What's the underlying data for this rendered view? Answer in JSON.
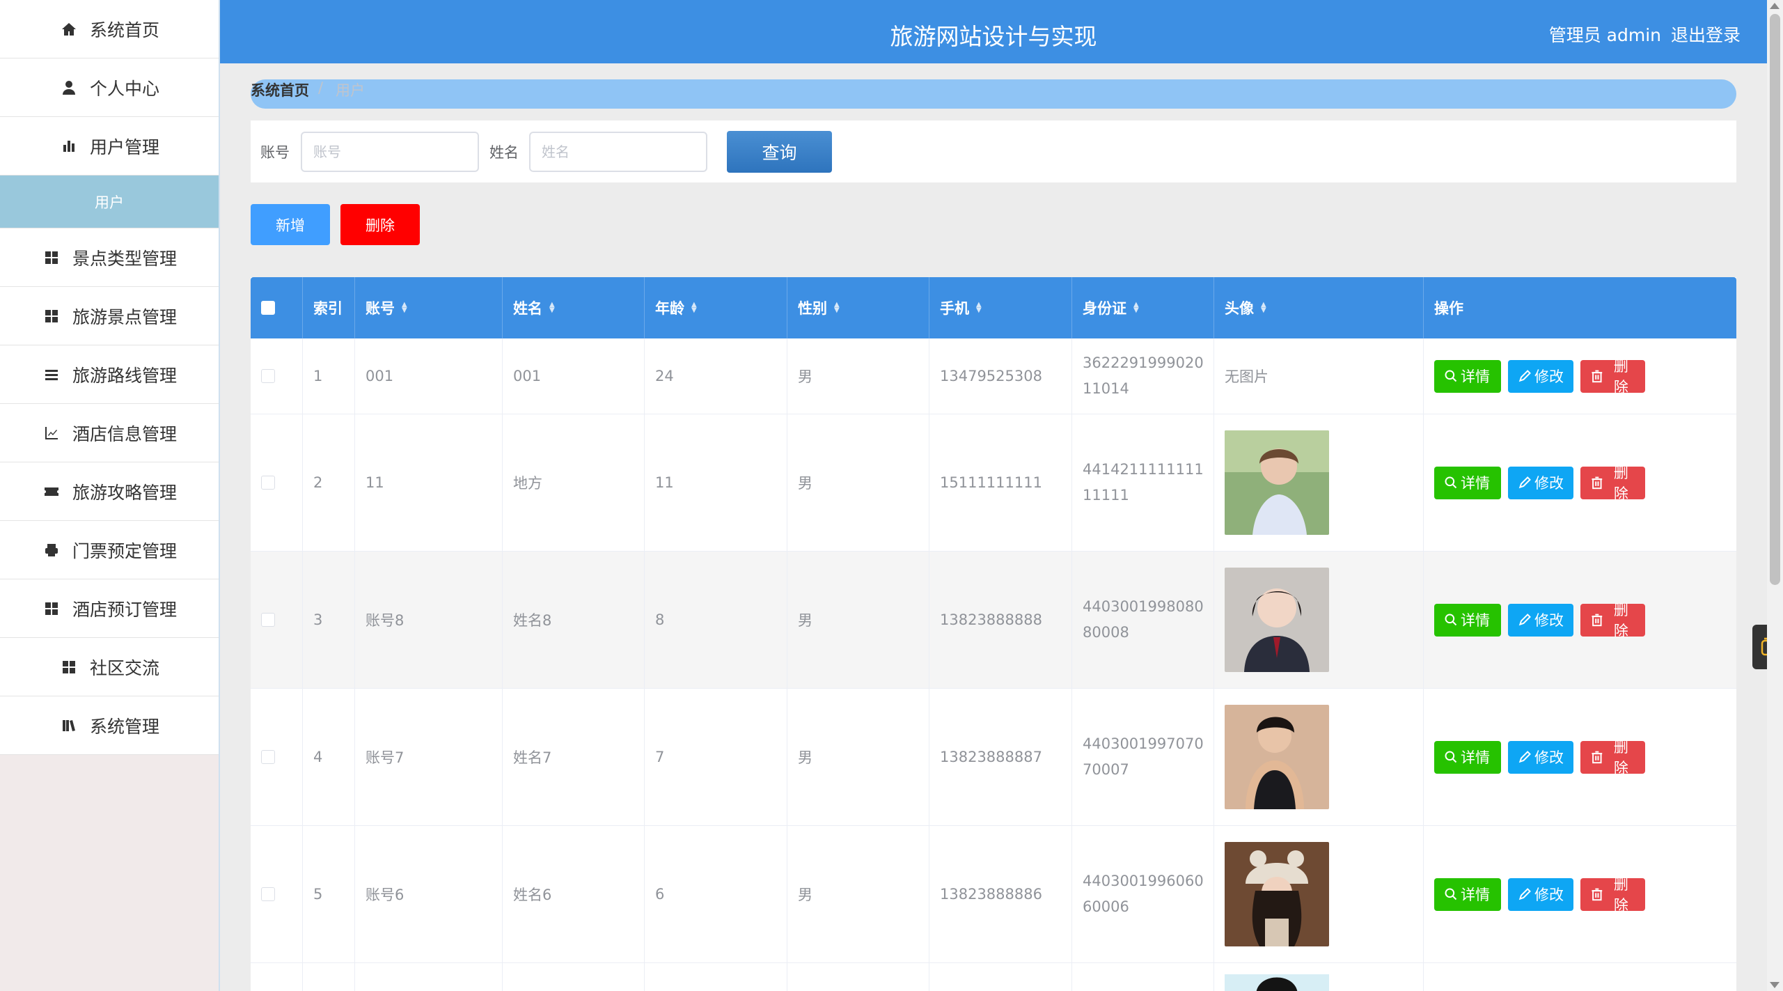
{
  "header": {
    "title": "旅游网站设计与实现",
    "user": "管理员 admin",
    "logout": "退出登录"
  },
  "sidebar": {
    "items": [
      {
        "label": "系统首页",
        "icon": "home-icon"
      },
      {
        "label": "个人中心",
        "icon": "person-icon"
      },
      {
        "label": "用户管理",
        "icon": "bar-chart-icon"
      },
      {
        "label": "景点类型管理",
        "icon": "grid-icon"
      },
      {
        "label": "旅游景点管理",
        "icon": "grid-icon"
      },
      {
        "label": "旅游路线管理",
        "icon": "list-icon"
      },
      {
        "label": "酒店信息管理",
        "icon": "line-chart-icon"
      },
      {
        "label": "旅游攻略管理",
        "icon": "ticket-icon"
      },
      {
        "label": "门票预定管理",
        "icon": "printer-icon"
      },
      {
        "label": "酒店预订管理",
        "icon": "grid-icon"
      },
      {
        "label": "社区交流",
        "icon": "grid-icon"
      },
      {
        "label": "系统管理",
        "icon": "books-icon"
      }
    ],
    "sub_active": "用户"
  },
  "breadcrumb": {
    "home": "系统首页",
    "separator": "/",
    "current": "用户"
  },
  "search": {
    "account_label": "账号",
    "account_placeholder": "账号",
    "name_label": "姓名",
    "name_placeholder": "姓名",
    "query_button": "查询"
  },
  "actions": {
    "add": "新增",
    "delete": "删除"
  },
  "table": {
    "columns": [
      "索引",
      "账号",
      "姓名",
      "年龄",
      "性别",
      "手机",
      "身份证",
      "头像",
      "操作"
    ],
    "op_labels": {
      "detail": "详情",
      "edit": "修改",
      "remove": "删除"
    },
    "rows": [
      {
        "index": "1",
        "account": "001",
        "name": "001",
        "age": "24",
        "gender": "男",
        "phone": "13479525308",
        "id_card": "362229199902011014",
        "avatar": "无图片"
      },
      {
        "index": "2",
        "account": "11",
        "name": "地方",
        "age": "11",
        "gender": "男",
        "phone": "15111111111",
        "id_card": "441421111111111111",
        "avatar": "photo"
      },
      {
        "index": "3",
        "account": "账号8",
        "name": "姓名8",
        "age": "8",
        "gender": "男",
        "phone": "13823888888",
        "id_card": "440300199808080008",
        "avatar": "photo"
      },
      {
        "index": "4",
        "account": "账号7",
        "name": "姓名7",
        "age": "7",
        "gender": "男",
        "phone": "13823888887",
        "id_card": "440300199707070007",
        "avatar": "photo"
      },
      {
        "index": "5",
        "account": "账号6",
        "name": "姓名6",
        "age": "6",
        "gender": "男",
        "phone": "13823888886",
        "id_card": "440300199606060006",
        "avatar": "photo"
      }
    ]
  },
  "colors": {
    "header_bg": "#3d8fe3",
    "submenu_bg": "#99c8dc",
    "add_button": "#409eff",
    "delete_button": "#ff0000",
    "detail_button": "#26c200",
    "edit_button": "#0ea6f4",
    "remove_button": "#e5464a"
  }
}
